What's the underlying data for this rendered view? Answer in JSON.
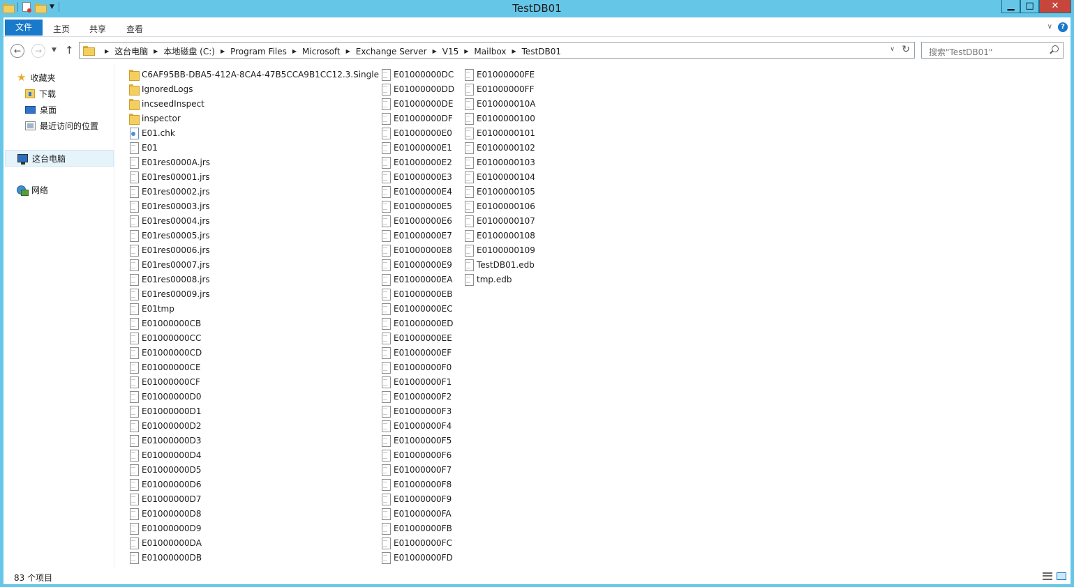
{
  "window": {
    "title": "TestDB01",
    "minimize_label": "▁",
    "maximize_label": "□",
    "close_label": "✕"
  },
  "ribbon": {
    "file_tab": "文件",
    "tabs": [
      "主页",
      "共享",
      "查看"
    ],
    "help_label": "?"
  },
  "address_bar": {
    "crumbs": [
      "这台电脑",
      "本地磁盘 (C:)",
      "Program Files",
      "Microsoft",
      "Exchange Server",
      "V15",
      "Mailbox",
      "TestDB01"
    ]
  },
  "search": {
    "placeholder": "搜索\"TestDB01\""
  },
  "nav_pane": {
    "favorites_label": "收藏夹",
    "downloads_label": "下载",
    "desktop_label": "桌面",
    "recent_label": "最近访问的位置",
    "this_pc_label": "这台电脑",
    "network_label": "网络"
  },
  "files": {
    "columns": [
      [
        {
          "name": "C6AF95BB-DBA5-412A-8CA4-47B5CCA9B1CC12.3.Single",
          "type": "folder"
        },
        {
          "name": "IgnoredLogs",
          "type": "folder"
        },
        {
          "name": "incseedInspect",
          "type": "folder"
        },
        {
          "name": "inspector",
          "type": "folder"
        },
        {
          "name": "E01.chk",
          "type": "chk"
        },
        {
          "name": "E01",
          "type": "file"
        },
        {
          "name": "E01res0000A.jrs",
          "type": "file"
        },
        {
          "name": "E01res00001.jrs",
          "type": "file"
        },
        {
          "name": "E01res00002.jrs",
          "type": "file"
        },
        {
          "name": "E01res00003.jrs",
          "type": "file"
        },
        {
          "name": "E01res00004.jrs",
          "type": "file"
        },
        {
          "name": "E01res00005.jrs",
          "type": "file"
        },
        {
          "name": "E01res00006.jrs",
          "type": "file"
        },
        {
          "name": "E01res00007.jrs",
          "type": "file"
        },
        {
          "name": "E01res00008.jrs",
          "type": "file"
        },
        {
          "name": "E01res00009.jrs",
          "type": "file"
        },
        {
          "name": "E01tmp",
          "type": "file"
        },
        {
          "name": "E01000000CB",
          "type": "file"
        },
        {
          "name": "E01000000CC",
          "type": "file"
        },
        {
          "name": "E01000000CD",
          "type": "file"
        },
        {
          "name": "E01000000CE",
          "type": "file"
        },
        {
          "name": "E01000000CF",
          "type": "file"
        },
        {
          "name": "E01000000D0",
          "type": "file"
        },
        {
          "name": "E01000000D1",
          "type": "file"
        },
        {
          "name": "E01000000D2",
          "type": "file"
        },
        {
          "name": "E01000000D3",
          "type": "file"
        },
        {
          "name": "E01000000D4",
          "type": "file"
        },
        {
          "name": "E01000000D5",
          "type": "file"
        },
        {
          "name": "E01000000D6",
          "type": "file"
        },
        {
          "name": "E01000000D7",
          "type": "file"
        },
        {
          "name": "E01000000D8",
          "type": "file"
        },
        {
          "name": "E01000000D9",
          "type": "file"
        },
        {
          "name": "E01000000DA",
          "type": "file"
        },
        {
          "name": "E01000000DB",
          "type": "file"
        }
      ],
      [
        {
          "name": "E01000000DC",
          "type": "file"
        },
        {
          "name": "E01000000DD",
          "type": "file"
        },
        {
          "name": "E01000000DE",
          "type": "file"
        },
        {
          "name": "E01000000DF",
          "type": "file"
        },
        {
          "name": "E01000000E0",
          "type": "file"
        },
        {
          "name": "E01000000E1",
          "type": "file"
        },
        {
          "name": "E01000000E2",
          "type": "file"
        },
        {
          "name": "E01000000E3",
          "type": "file"
        },
        {
          "name": "E01000000E4",
          "type": "file"
        },
        {
          "name": "E01000000E5",
          "type": "file"
        },
        {
          "name": "E01000000E6",
          "type": "file"
        },
        {
          "name": "E01000000E7",
          "type": "file"
        },
        {
          "name": "E01000000E8",
          "type": "file"
        },
        {
          "name": "E01000000E9",
          "type": "file"
        },
        {
          "name": "E01000000EA",
          "type": "file"
        },
        {
          "name": "E01000000EB",
          "type": "file"
        },
        {
          "name": "E01000000EC",
          "type": "file"
        },
        {
          "name": "E01000000ED",
          "type": "file"
        },
        {
          "name": "E01000000EE",
          "type": "file"
        },
        {
          "name": "E01000000EF",
          "type": "file"
        },
        {
          "name": "E01000000F0",
          "type": "file"
        },
        {
          "name": "E01000000F1",
          "type": "file"
        },
        {
          "name": "E01000000F2",
          "type": "file"
        },
        {
          "name": "E01000000F3",
          "type": "file"
        },
        {
          "name": "E01000000F4",
          "type": "file"
        },
        {
          "name": "E01000000F5",
          "type": "file"
        },
        {
          "name": "E01000000F6",
          "type": "file"
        },
        {
          "name": "E01000000F7",
          "type": "file"
        },
        {
          "name": "E01000000F8",
          "type": "file"
        },
        {
          "name": "E01000000F9",
          "type": "file"
        },
        {
          "name": "E01000000FA",
          "type": "file"
        },
        {
          "name": "E01000000FB",
          "type": "file"
        },
        {
          "name": "E01000000FC",
          "type": "file"
        },
        {
          "name": "E01000000FD",
          "type": "file"
        }
      ],
      [
        {
          "name": "E01000000FE",
          "type": "file"
        },
        {
          "name": "E01000000FF",
          "type": "file"
        },
        {
          "name": "E010000010A",
          "type": "file"
        },
        {
          "name": "E0100000100",
          "type": "file"
        },
        {
          "name": "E0100000101",
          "type": "file"
        },
        {
          "name": "E0100000102",
          "type": "file"
        },
        {
          "name": "E0100000103",
          "type": "file"
        },
        {
          "name": "E0100000104",
          "type": "file"
        },
        {
          "name": "E0100000105",
          "type": "file"
        },
        {
          "name": "E0100000106",
          "type": "file"
        },
        {
          "name": "E0100000107",
          "type": "file"
        },
        {
          "name": "E0100000108",
          "type": "file"
        },
        {
          "name": "E0100000109",
          "type": "file"
        },
        {
          "name": "TestDB01.edb",
          "type": "file"
        },
        {
          "name": "tmp.edb",
          "type": "file"
        }
      ]
    ]
  },
  "status_bar": {
    "item_count": "83 个项目"
  },
  "colors": {
    "title_bar": "#66c6e8",
    "file_tab": "#1979ca",
    "close_button": "#c7463c",
    "selected_nav": "#e5f3fb"
  }
}
